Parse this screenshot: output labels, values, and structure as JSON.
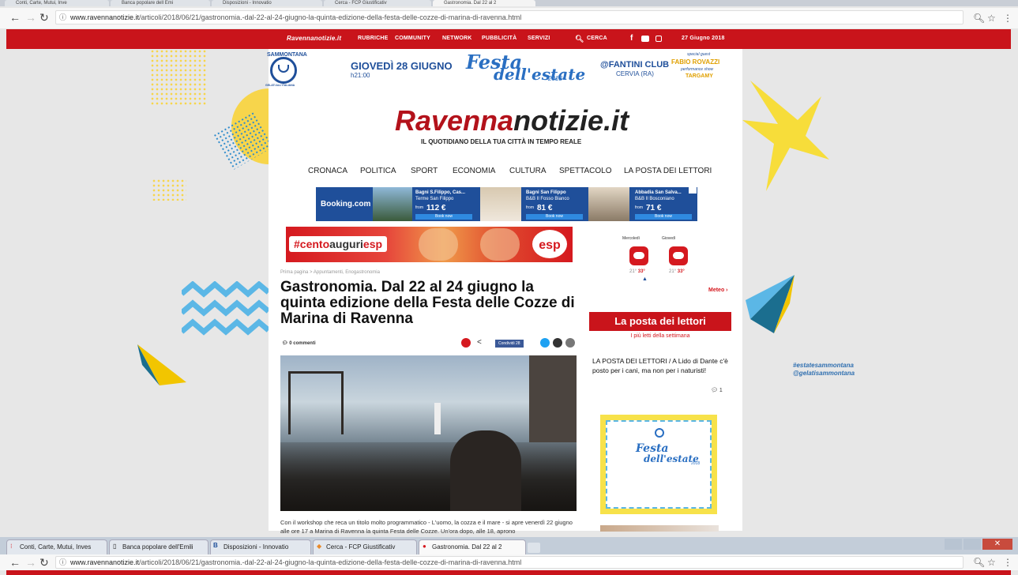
{
  "browser_top": {
    "tabs": [
      "Conti, Carte, Mutui, Inve",
      "Banca popolare dell Emi",
      "Disposizioni - Innovatio",
      "Cerca - FCP Giustificativ",
      "Gastronomia. Dal 22 al 2"
    ],
    "url_host": "www.ravennanotizie.it",
    "url_path": "/articoli/2018/06/21/gastronomia.-dal-22-al-24-giugno-la-quinta-edizione-della-festa-delle-cozze-di-marina-di-ravenna.html"
  },
  "site_nav": {
    "brand": "Ravennanotizie.it",
    "items": [
      "RUBRICHE",
      "COMMUNITY",
      "NETWORK",
      "PUBBLICITÀ",
      "SERVIZI"
    ],
    "search": "CERCA",
    "date": "27 Giugno 2018"
  },
  "promo_banner": {
    "sponsor": "SAMMONTANA",
    "sponsor_sub": "GELATI ALL'ITALIANA",
    "date": "GIOVEDÌ 28 GIUGNO",
    "time": "h21:00",
    "event_1": "Festa",
    "event_2": "dell'estate",
    "event_year": "2018",
    "venue": "@FANTINI CLUB",
    "venue_city": "CERVIA (RA)",
    "guest_label": "special guest",
    "guest": "FABIO ROVAZZI",
    "performer_label": "performance show",
    "performer": "TARGAMY"
  },
  "masthead": {
    "logo_red": "Ravenna",
    "logo_dark": "notizie.it",
    "tagline": "IL QUOTIDIANO DELLA TUA CITTÀ IN TEMPO REALE"
  },
  "main_menu": [
    "CRONACA",
    "POLITICA",
    "SPORT",
    "ECONOMIA",
    "CULTURA",
    "SPETTACOLO",
    "LA POSTA DEI LETTORI"
  ],
  "booking_ad": {
    "logo": "Booking.com",
    "hotels": [
      {
        "name": "Bagni S.Filippo, Cas...",
        "sub": "Terme San Filippo",
        "price": "112 €",
        "cta": "Book now"
      },
      {
        "name": "Bagni San Filippo",
        "sub": "B&B Il Fosso Bianco",
        "price": "81 €",
        "cta": "Book now"
      },
      {
        "name": "Abbadia San Salva...",
        "sub": "B&B Il Bosconiano",
        "price": "71 €",
        "cta": "Book now"
      }
    ],
    "from_label": "from"
  },
  "esp_ad": {
    "hashtag_1": "#cento",
    "hashtag_2": "auguri",
    "hashtag_3": "esp",
    "logo": "esp"
  },
  "article": {
    "breadcrumb": "Prima pagina > Appuntamenti, Enogastronomia",
    "title": "Gastronomia. Dal 22 al 24 giugno la quinta edizione della Festa delle Cozze di Marina di Ravenna",
    "comments": "0 commenti",
    "share_label": "Condividi 28",
    "body": "Con il workshop che reca un titolo molto programmatico - L'uomo, la cozza e il mare - si apre venerdì 22 giugno alle ore 17 a Marina di Ravenna la quinta Festa delle Cozze. Un'ora dopo, alle 18, aprono"
  },
  "weather": {
    "days": [
      {
        "label": "Mercoledì",
        "low": "21°",
        "high": "33°"
      },
      {
        "label": "Giovedì",
        "low": "21°",
        "high": "33°"
      }
    ],
    "link": "Meteo"
  },
  "sidebar": {
    "section_title": "La posta dei lettori",
    "section_sub": "I più letti della settimana",
    "post_title": "LA POSTA DEI LETTORI / A Lido di Dante c'è posto per i cani, ma non per i naturisti!",
    "post_comments": "1",
    "promo_1": "Festa",
    "promo_2": "dell'estate",
    "promo_year": "2018"
  },
  "hashtags": [
    "#estatesammontana",
    "@gelatisammontana"
  ],
  "browser_bottom": {
    "tabs": [
      "Conti, Carte, Mutui, Inves",
      "Banca popolare dell'Emili",
      "Disposizioni - Innovatio",
      "Cerca - FCP Giustificativ",
      "Gastronomia. Dal 22 al 2"
    ],
    "url_host": "www.ravennanotizie.it",
    "url_path": "/articoli/2018/06/21/gastronomia.-dal-22-al-24-giugno-la-quinta-edizione-della-festa-delle-cozze-di-marina-di-ravenna.html"
  },
  "colors": {
    "brand_red": "#c9141b",
    "booking_blue": "#1f4f9a",
    "sammontana_yellow": "#f7d54b",
    "wave_blue": "#5bb7e6"
  }
}
